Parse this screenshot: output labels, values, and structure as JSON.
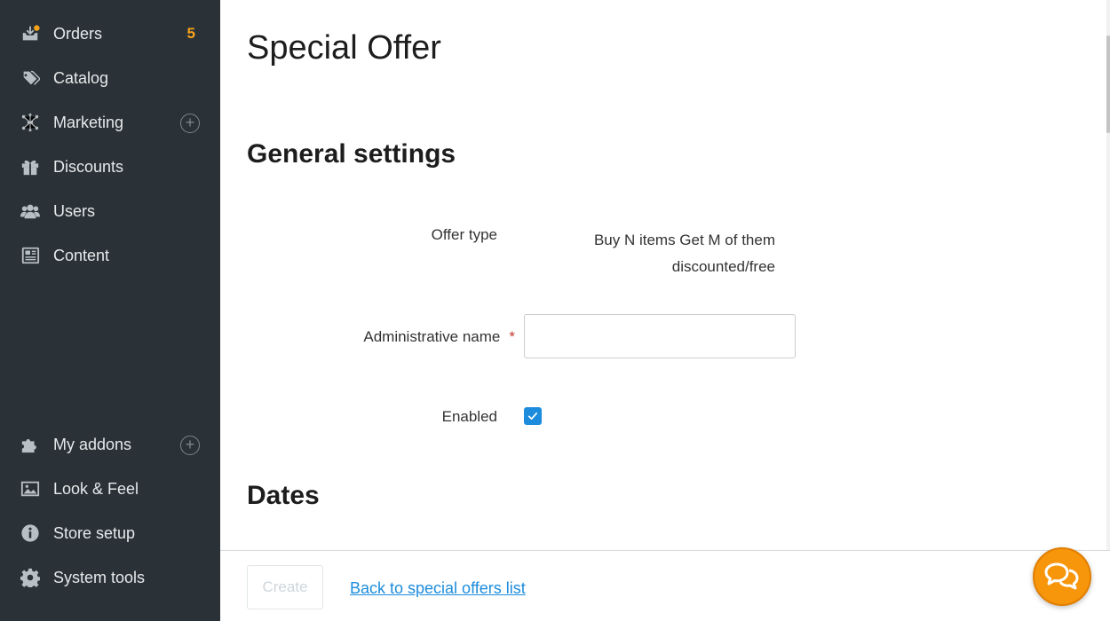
{
  "sidebar": {
    "items": [
      {
        "label": "Orders",
        "icon": "orders-icon",
        "badge": "5"
      },
      {
        "label": "Catalog",
        "icon": "tags-icon"
      },
      {
        "label": "Marketing",
        "icon": "network-icon",
        "plus": "+"
      },
      {
        "label": "Discounts",
        "icon": "gift-icon"
      },
      {
        "label": "Users",
        "icon": "users-icon"
      },
      {
        "label": "Content",
        "icon": "newspaper-icon"
      },
      {
        "label": "My addons",
        "icon": "puzzle-icon",
        "plus": "+"
      },
      {
        "label": "Look & Feel",
        "icon": "image-icon"
      },
      {
        "label": "Store setup",
        "icon": "info-icon"
      },
      {
        "label": "System tools",
        "icon": "gear-icon"
      }
    ]
  },
  "main": {
    "title": "Special Offer",
    "sections": {
      "general": "General settings",
      "dates": "Dates"
    },
    "fields": {
      "offer_type_label": "Offer type",
      "offer_type_value": "Buy N items Get M of them discounted/free",
      "admin_name_label": "Administrative name",
      "admin_name_required": "*",
      "admin_name_value": "",
      "enabled_label": "Enabled",
      "enabled_checked": true
    }
  },
  "footer": {
    "create_label": "Create",
    "back_link": "Back to special offers list"
  },
  "colors": {
    "sidebar_bg": "#2a3237",
    "accent": "#1d8cdc",
    "badge": "#f7a21b",
    "chat": "#f7950b"
  }
}
